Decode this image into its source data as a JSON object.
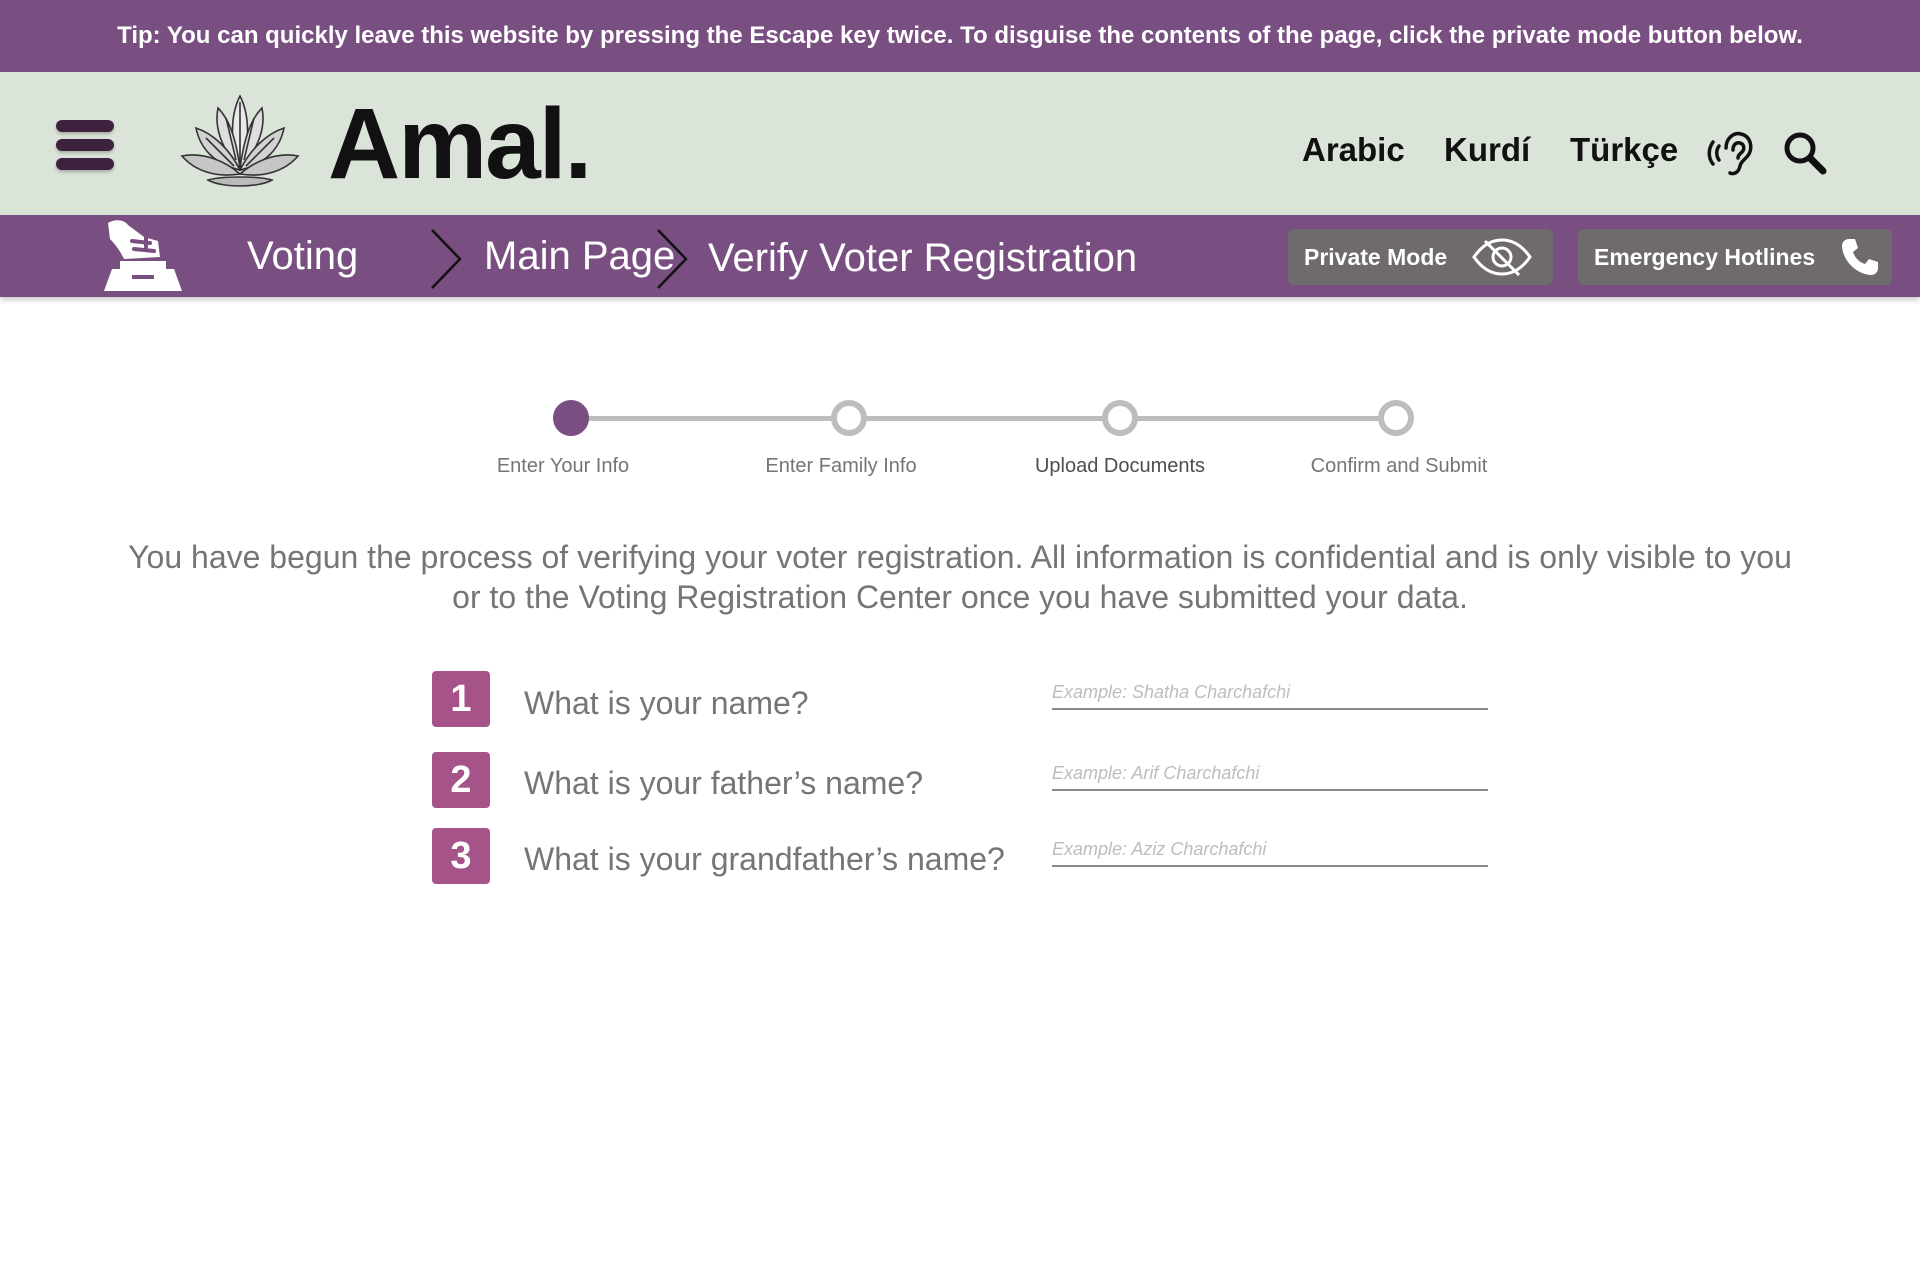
{
  "tip": {
    "text": "Tip: You can quickly leave this website by pressing the Escape key twice. To disguise the contents of the page, click the private mode button below."
  },
  "header": {
    "logo_text": "Amal.",
    "languages": [
      "Arabic",
      "Kurdí",
      "Türkçe"
    ],
    "icons": [
      "menu-icon",
      "lotus-logo-icon",
      "hearing-icon",
      "search-icon"
    ]
  },
  "breadcrumb": {
    "section": "Voting",
    "items": [
      "Main Page",
      "Verify Voter Registration"
    ]
  },
  "actions": {
    "private_mode": "Private Mode",
    "emergency": "Emergency Hotlines"
  },
  "steps": [
    {
      "label": "Enter Your Info",
      "state": "current"
    },
    {
      "label": "Enter Family Info",
      "state": "pending"
    },
    {
      "label": "Upload Documents",
      "state": "pending"
    },
    {
      "label": "Confirm and Submit",
      "state": "pending"
    }
  ],
  "intro": "You have begun the process of verifying your voter registration. All information is confidential and is only visible to you or to the Voting Registration Center once you have submitted your data.",
  "questions": [
    {
      "number": "1",
      "label": "What is your name?",
      "placeholder": "Example: Shatha Charchafchi",
      "value": ""
    },
    {
      "number": "2",
      "label": "What is your father’s name?",
      "placeholder": "Example: Arif Charchafchi",
      "value": ""
    },
    {
      "number": "3",
      "label": "What is your grandfather’s name?",
      "placeholder": "Example: Aziz Charchafchi",
      "value": ""
    }
  ],
  "colors": {
    "primary": "#794f82",
    "header_bg": "#dbe4d9",
    "pill_bg": "#6e6a6d",
    "number_badge": "#a6538a",
    "muted_text": "#757575"
  }
}
